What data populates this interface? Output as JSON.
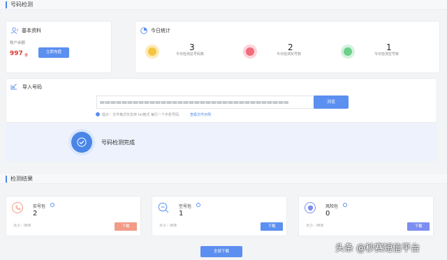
{
  "section1": {
    "title": "号码检测"
  },
  "basic": {
    "title": "基本资料",
    "balance_label": "账户余额",
    "balance_value": "997",
    "balance_unit": "条",
    "recharge_btn": "立即充值"
  },
  "today": {
    "title": "今日统计",
    "stats": [
      {
        "value": "3",
        "label": "今日检测总号码数",
        "color": "#f5c542"
      },
      {
        "value": "2",
        "label": "今日检测实号数",
        "color": "#f06b7b"
      },
      {
        "value": "1",
        "label": "今日检测空号数",
        "color": "#6ccf8a"
      }
    ]
  },
  "import": {
    "title": "导入号码",
    "file_placeholder": "",
    "browse_btn": "浏览",
    "hint": "提示：文件格式仅支持 txt格式 每行一个手机号码,",
    "example_link": "查看文件示例"
  },
  "progress": {
    "status": "号码检测完成"
  },
  "section2": {
    "title": "检测结果"
  },
  "results": [
    {
      "name": "实号包",
      "count": "2",
      "size": "大小：0KB",
      "btn": "下载",
      "btn_color": "#f29b86",
      "icon_color": "#f29b86"
    },
    {
      "name": "空号包",
      "count": "1",
      "size": "大小：0KB",
      "btn": "下载",
      "btn_color": "#5b8ff0",
      "icon_color": "#5b8ff0"
    },
    {
      "name": "风险包",
      "count": "0",
      "size": "大小：0KB",
      "btn": "下载",
      "btn_color": "#7c8ef0",
      "icon_color": "#7c8ef0"
    }
  ],
  "all_download": "全部下载",
  "watermark": "头条 @秒赛短信平台"
}
